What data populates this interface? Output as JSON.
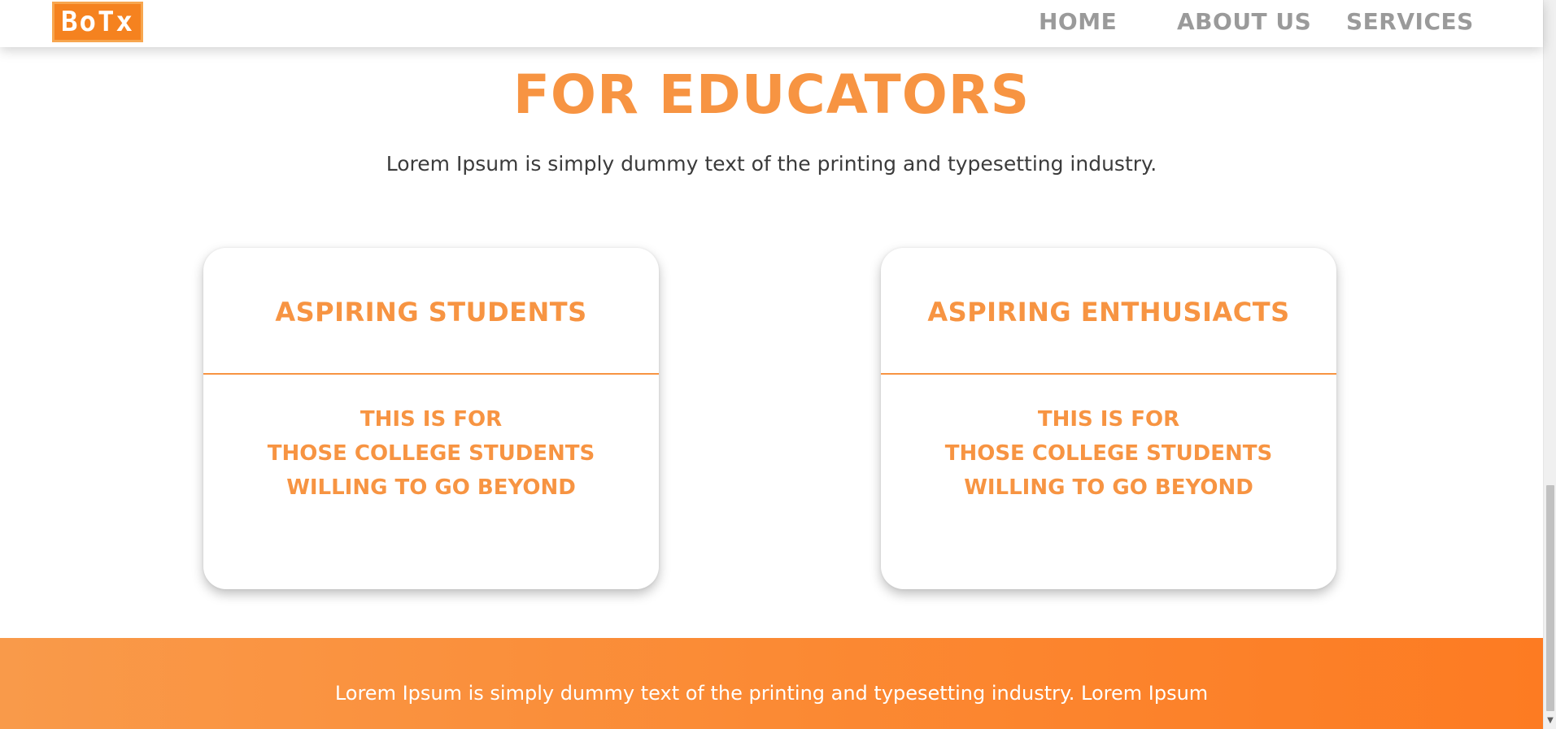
{
  "header": {
    "logo_text": "BoTx",
    "nav": {
      "home": "HOME",
      "about": "ABOUT US",
      "services": "SERVICES"
    }
  },
  "section": {
    "title": "FOR EDUCATORS",
    "subtitle": "Lorem Ipsum is simply dummy text of the printing and typesetting industry."
  },
  "cards": [
    {
      "title": "ASPIRING STUDENTS",
      "lines": [
        "THIS IS FOR",
        "THOSE COLLEGE STUDENTS",
        "WILLING TO GO BEYOND"
      ]
    },
    {
      "title": "ASPIRING ENTHUSIACTS",
      "lines": [
        "THIS IS FOR",
        "THOSE COLLEGE STUDENTS",
        "WILLING TO GO BEYOND"
      ]
    }
  ],
  "footer": {
    "text": "Lorem Ipsum is simply dummy text of the printing and typesetting industry. Lorem Ipsum"
  },
  "colors": {
    "accent": "#f79442",
    "nav_text": "#9a9a9a",
    "footer_start": "#f99a4a",
    "footer_end": "#fd7b22"
  },
  "icons": {
    "scroll_down": "scroll-down-arrow-icon"
  }
}
